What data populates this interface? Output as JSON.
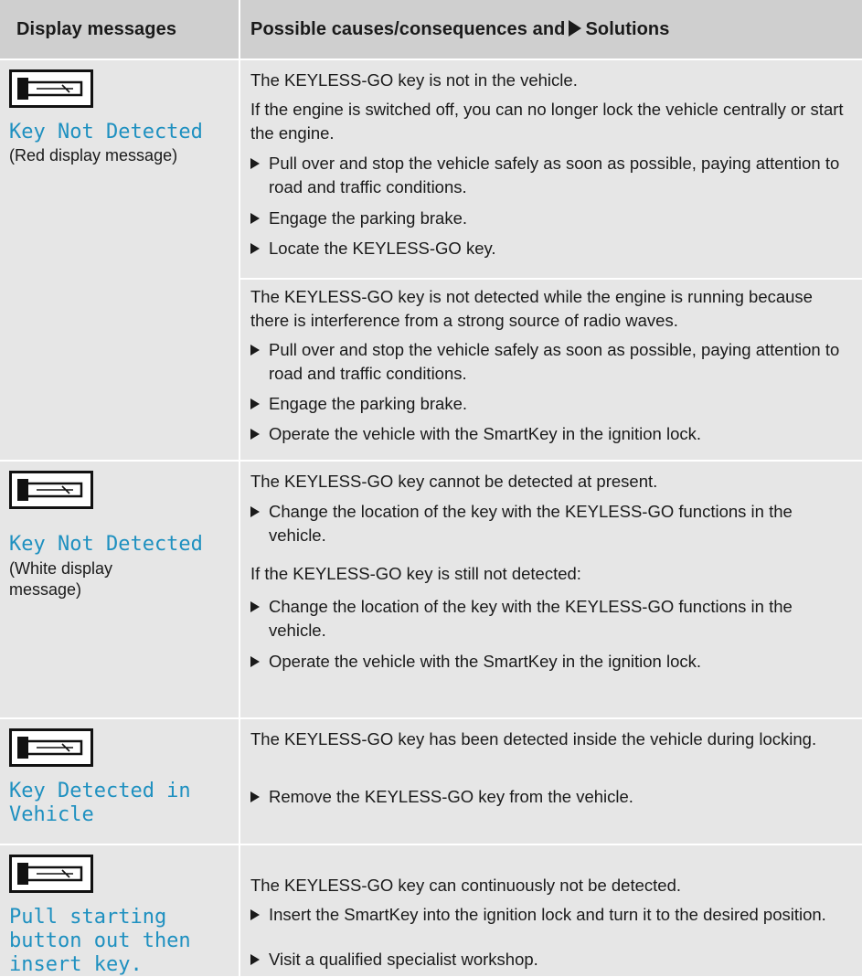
{
  "header": {
    "col1": "Display messages",
    "col2_prefix": "Possible causes/consequences and",
    "col2_suffix": "Solutions"
  },
  "rows": [
    {
      "icon": "key-icon",
      "message": "Key Not Detected",
      "note": "(Red display message)",
      "message_color": "#1e90c0",
      "blocks": [
        {
          "para1": "The KEYLESS-GO key is not in the vehicle.",
          "para2": "If the engine is switched off, you can no longer lock the vehicle centrally or start the engine.",
          "bullets": [
            "Pull over and stop the vehicle safely as soon as possible, paying attention to road and traffic conditions.",
            "Engage the parking brake.",
            "Locate the KEYLESS-GO key."
          ]
        },
        {
          "para1": "The KEYLESS-GO key is not detected while the engine is running because there is interference from a strong source of radio waves.",
          "bullets": [
            "Pull over and stop the vehicle safely as soon as possible, paying attention to road and traffic conditions.",
            "Engage the parking brake.",
            "Operate the vehicle with the SmartKey in the ignition lock."
          ]
        }
      ]
    },
    {
      "icon": "key-icon",
      "message": "Key Not Detected",
      "note": "(White display message)",
      "para1": "The KEYLESS-GO key cannot be detected at present.",
      "bullet1": "Change the location of the key with the KEYLESS-GO functions in the vehicle.",
      "para2": "If the KEYLESS-GO key is still not detected:",
      "bullet2": "Change the location of the key with the KEYLESS-GO functions in the vehicle.",
      "bullet3": "Operate the vehicle with the SmartKey in the ignition lock."
    },
    {
      "icon": "key-icon",
      "message": "Key Detected in Vehicle",
      "para1": "The KEYLESS-GO key has been detected inside the vehicle during locking.",
      "bullet1": "Remove the KEYLESS-GO key from the vehicle."
    },
    {
      "icon": "key-icon",
      "message": "Pull starting button out then insert key.",
      "para1": "The KEYLESS-GO key can continuously not be detected.",
      "bullet1": "Insert the SmartKey into the ignition lock and turn it to the desired position.",
      "bullet2": "Visit a qualified specialist workshop."
    }
  ]
}
